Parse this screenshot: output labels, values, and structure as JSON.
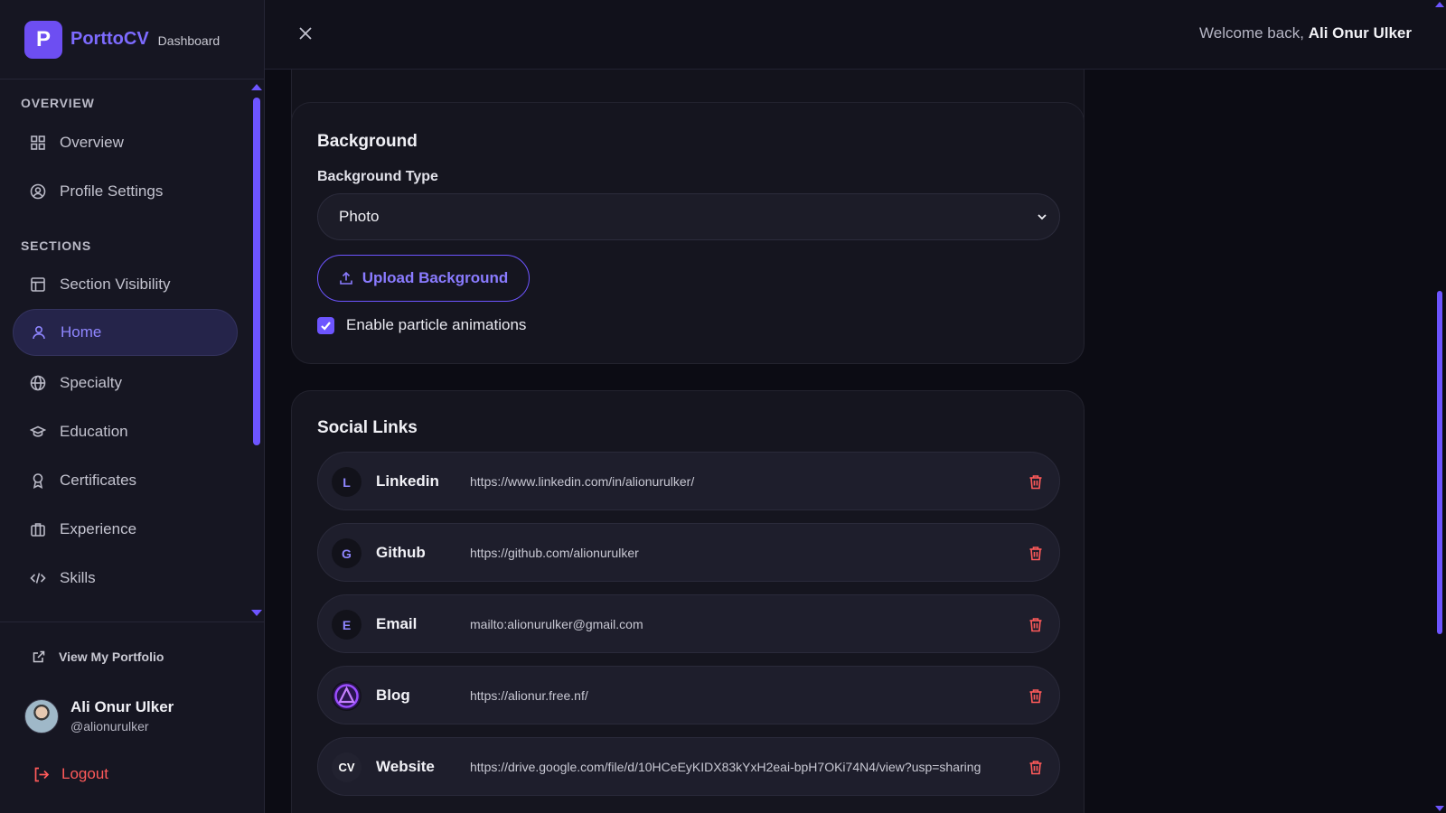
{
  "brand": {
    "logo_letter": "P",
    "name": "PorttoCV",
    "subtitle": "Dashboard"
  },
  "sidebar": {
    "overview_heading": "OVERVIEW",
    "sections_heading": "SECTIONS",
    "items": [
      {
        "label": "Overview",
        "icon": "grid-icon"
      },
      {
        "label": "Profile Settings",
        "icon": "user-circle-icon"
      },
      {
        "label": "Section Visibility",
        "icon": "layout-icon"
      },
      {
        "label": "Home",
        "icon": "user-icon",
        "active": true
      },
      {
        "label": "Specialty",
        "icon": "globe-icon"
      },
      {
        "label": "Education",
        "icon": "graduation-cap-icon"
      },
      {
        "label": "Certificates",
        "icon": "award-icon"
      },
      {
        "label": "Experience",
        "icon": "briefcase-icon"
      },
      {
        "label": "Skills",
        "icon": "code-icon"
      }
    ],
    "view_portfolio": "View My Portfolio",
    "user": {
      "name": "Ali Onur Ulker",
      "handle": "@alionurulker"
    },
    "logout": "Logout"
  },
  "topbar": {
    "welcome_prefix": "Welcome back,",
    "welcome_name": "Ali Onur Ulker"
  },
  "background": {
    "title": "Background",
    "type_label": "Background Type",
    "type_value": "Photo",
    "upload_label": "Upload Background",
    "particles_label": "Enable particle animations",
    "particles_checked": true
  },
  "social": {
    "title": "Social Links",
    "links": [
      {
        "badge": "L",
        "name": "Linkedin",
        "url": "https://www.linkedin.com/in/alionurulker/"
      },
      {
        "badge": "G",
        "name": "Github",
        "url": "https://github.com/alionurulker"
      },
      {
        "badge": "E",
        "name": "Email",
        "url": "mailto:alionurulker@gmail.com"
      },
      {
        "badge": "",
        "name": "Blog",
        "url": "https://alionur.free.nf/"
      },
      {
        "badge": "CV",
        "name": "Website",
        "url": "https://drive.google.com/file/d/10HCeEyKIDX83kYxH2eai-bpH7OKi74N4/view?usp=sharing"
      }
    ]
  },
  "colors": {
    "accent": "#6d55ff",
    "danger": "#ff5a5a",
    "bg": "#0c0c14",
    "card": "#15151f"
  }
}
